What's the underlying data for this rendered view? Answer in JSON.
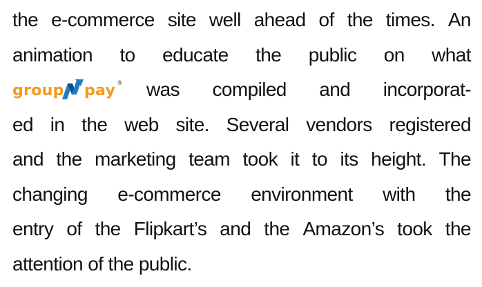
{
  "paragraph": {
    "line1": [
      "the",
      "e-commerce",
      "site",
      "well",
      "ahead",
      "of",
      "the",
      "times.",
      "An"
    ],
    "line2": [
      "animation",
      "to",
      "educate",
      "the",
      "public",
      "on",
      "what"
    ],
    "line3_after_logo": [
      "was",
      "compiled",
      "and",
      "incorporat-"
    ],
    "line4": [
      "ed",
      "in",
      "the",
      "web",
      "site.",
      "Several",
      "vendors",
      "registered"
    ],
    "line5": [
      "and",
      "the",
      "marketing",
      "team",
      "took",
      "it",
      "to",
      "its",
      "height.",
      "The"
    ],
    "line6": [
      "changing",
      "e-commerce",
      "environment",
      "with",
      "the"
    ],
    "line7": [
      "entry",
      "of",
      "the",
      "Flipkart’s",
      "and",
      "the",
      "Amazon’s",
      "took",
      "the"
    ],
    "line8": "attention of the public."
  },
  "logo": {
    "text_left": "group",
    "text_right": "pay",
    "registered_mark": "®",
    "colors": {
      "orange": "#F39A1E",
      "blue": "#1F7BC4",
      "dark_blue": "#0E4E8C"
    }
  }
}
